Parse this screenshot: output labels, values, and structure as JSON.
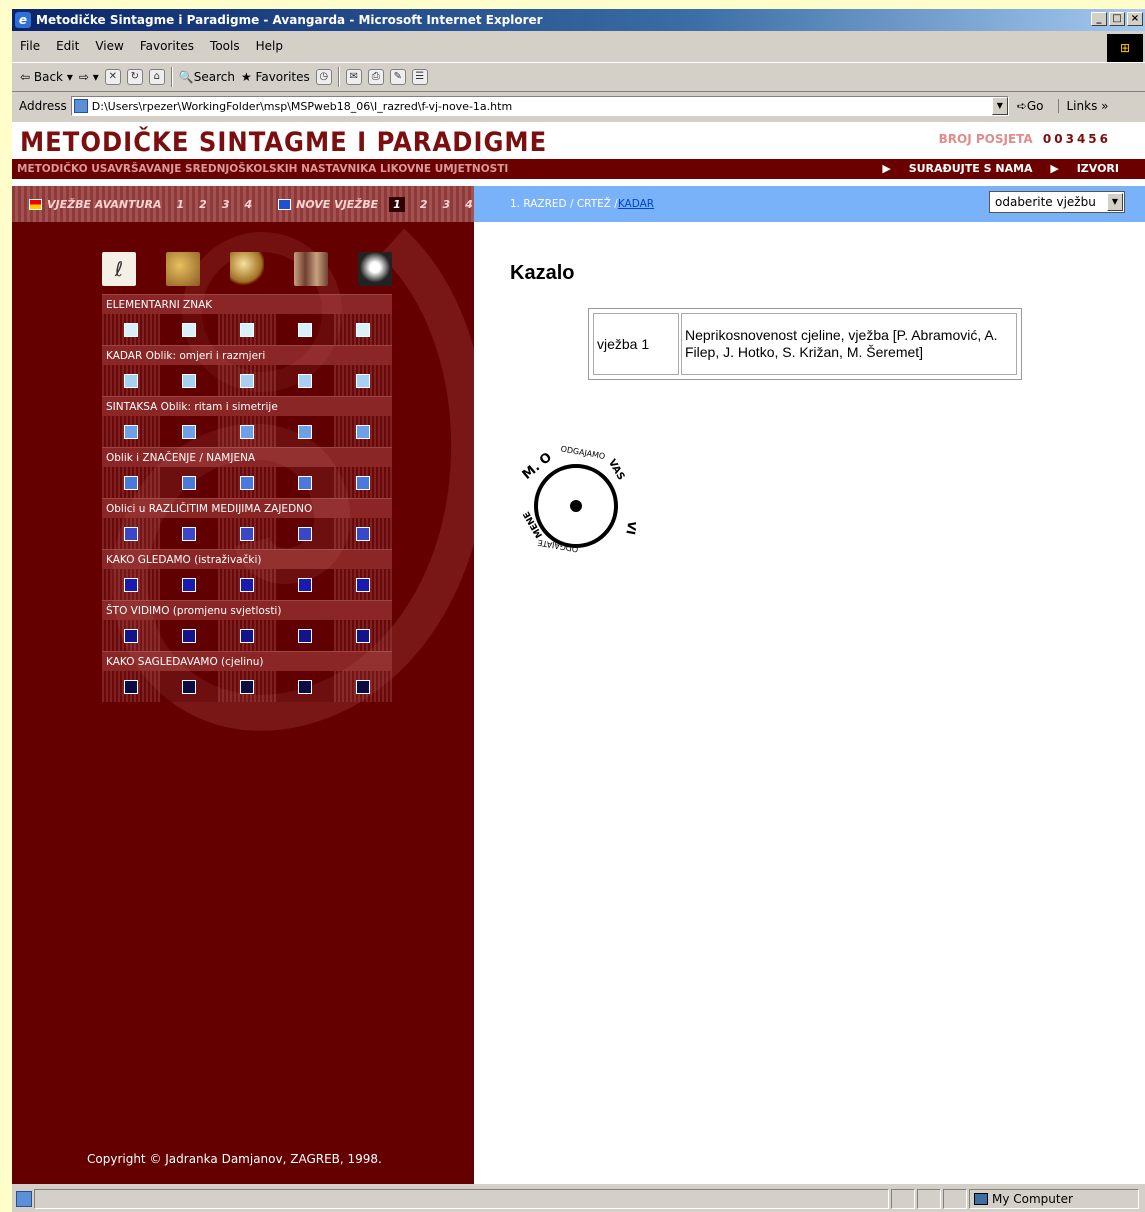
{
  "window": {
    "title": "Metodičke Sintagme i Paradigme - Avangarda - Microsoft Internet Explorer",
    "controls": [
      "_",
      "□",
      "×"
    ]
  },
  "menu": [
    "File",
    "Edit",
    "View",
    "Favorites",
    "Tools",
    "Help"
  ],
  "toolbar": {
    "back": "Back",
    "search": "Search",
    "favorites": "Favorites"
  },
  "address": {
    "label": "Address",
    "url": "D:\\Users\\rpezer\\WorkingFolder\\msp\\MSPweb18_06\\I_razred\\f-vj-nove-1a.htm",
    "go": "Go",
    "links": "Links"
  },
  "status": {
    "zone": "My Computer"
  },
  "page": {
    "title": "METODIČKE SINTAGME I PARADIGME",
    "subtitle": "METODIČKO USAVRŠAVANJE SREDNJOŠKOLSKIH NASTAVNIKA LIKOVNE UMJETNOSTI",
    "visits_label": "BROJ POSJETA",
    "visits_value": "003456",
    "head_links": [
      "SURAĐUJTE S NAMA",
      "IZVORI"
    ],
    "nav": {
      "avantura_label": "VJEŽBE AVANTURA",
      "avantura_numbers": [
        "1",
        "2",
        "3",
        "4"
      ],
      "nove_label": "NOVE VJEŽBE",
      "nove_numbers": [
        "1",
        "2",
        "3",
        "4"
      ],
      "breadcrumb_text": "1. RAZRED / CRTEŽ / ",
      "breadcrumb_link": "KADAR",
      "select_value": "odaberite vježbu"
    },
    "sidebar": {
      "thumbnails": [
        "signature-thumb",
        "painting-thumb",
        "sphere-thumb",
        "sculpture-thumb",
        "portrait-thumb"
      ],
      "groups": [
        {
          "label": "ELEMENTARNI ZNAK",
          "color": "#d8f0f8"
        },
        {
          "label": "KADAR Oblik: omjeri i razmjeri",
          "color": "#a8d0f0"
        },
        {
          "label": "SINTAKSA Oblik: ritam i simetrije",
          "color": "#6ea0e8"
        },
        {
          "label": "Oblik i ZNAČENJE / NAMJENA",
          "color": "#4a78dc"
        },
        {
          "label": "Oblici u RAZLIČITIM MEDIJIMA ZAJEDNO",
          "color": "#3848c8"
        },
        {
          "label": "KAKO GLEDAMO (istraživački)",
          "color": "#1a1ab0"
        },
        {
          "label": "ŠTO VIDIMO (promjenu svjetlosti)",
          "color": "#14148a"
        },
        {
          "label": "KAKO SAGLEDAVAMO (cjelinu)",
          "color": "#0c0c40"
        }
      ],
      "copyright": "Copyright © Jadranka Damjanov, ZAGREB, 1998."
    },
    "main": {
      "heading": "Kazalo",
      "table": [
        {
          "exercise": "vježba 1",
          "description": "Neprikosnovenost cjeline, vježba [P. Abramović, A. Filep, J. Hotko, S. Križan, M. Šeremet]"
        }
      ],
      "stamp_text": [
        "M. O",
        "ODGAJAMO",
        "VAS",
        "VI",
        "ODGAJATE",
        "MENE"
      ]
    }
  },
  "colors": {
    "brand": "#7b0f0f",
    "sidebar": "#640000",
    "nav_blue": "#7ab2f9"
  }
}
